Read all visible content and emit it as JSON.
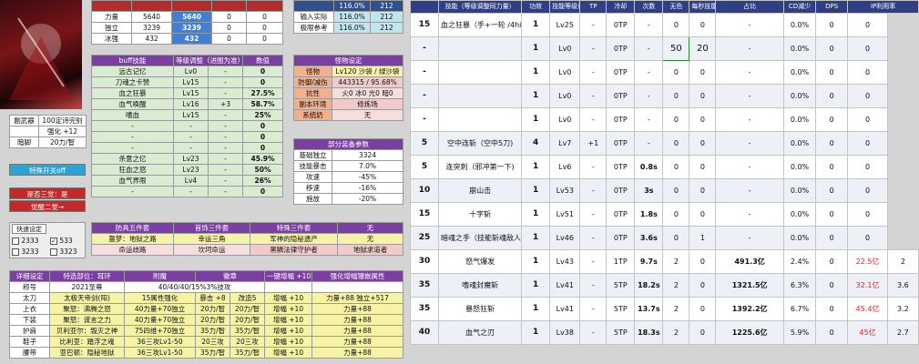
{
  "top_stats": {
    "rows": [
      [
        "力量",
        "5640",
        "5640",
        "0",
        "0"
      ],
      [
        "独立",
        "3239",
        "3239",
        "0",
        "0"
      ],
      [
        "冰强",
        "432",
        "432",
        "0",
        "0"
      ]
    ]
  },
  "top_info": {
    "headers": [
      "",
      "116.0%",
      "212"
    ],
    "rows": [
      [
        "输入实际",
        "116.0%",
        "212"
      ],
      [
        "极限参考",
        "116.0%",
        "212"
      ]
    ]
  },
  "weapon": {
    "rows": [
      [
        "副武器",
        "100定诗完别"
      ],
      [
        "",
        "强化 +12"
      ],
      [
        "暗脚",
        "20力/智"
      ]
    ]
  },
  "buttons": {
    "special_off": "特殊开关off",
    "is_three": "是否三觉：是",
    "awaken2": "觉醒二觉→",
    "quick_set": "快速设定"
  },
  "quick": {
    "items": [
      {
        "check": "",
        "val": "2333"
      },
      {
        "check": "✓",
        "val": "533"
      },
      {
        "check": "",
        "val": "3233"
      },
      {
        "check": "",
        "val": "3323"
      },
      {
        "check": "",
        "val": "3332"
      }
    ]
  },
  "buff": {
    "headers": [
      "buff技能",
      "等级调整（进图为准）",
      "数值"
    ],
    "rows": [
      [
        "远古记忆",
        "Lv0",
        "-",
        "0"
      ],
      [
        "刀魂之卡赞",
        "Lv15",
        "-",
        "0"
      ],
      [
        "血之狂暴",
        "Lv15",
        "-",
        "27.5%"
      ],
      [
        "血气唤醒",
        "Lv16",
        "+3",
        "58.7%"
      ],
      [
        "嗜血",
        "Lv15",
        "-",
        "25%"
      ],
      [
        "-",
        "-",
        "-",
        "0"
      ],
      [
        "-",
        "-",
        "-",
        "0"
      ],
      [
        "-",
        "-",
        "-",
        "0"
      ],
      [
        "杀意之忆",
        "Lv23",
        "-",
        "45.9%"
      ],
      [
        "狂血之怒",
        "Lv23",
        "-",
        "50%"
      ],
      [
        "血气界限",
        "Lv4",
        "-",
        "26%"
      ],
      [
        "-",
        "-",
        "-",
        "0"
      ]
    ]
  },
  "monster": {
    "header": "怪物设定",
    "rows": [
      [
        "怪物",
        "Lv120 沙袋 / 绿沙袋"
      ],
      [
        "防御/减伤",
        "443315 / 95.68%"
      ],
      [
        "抗性",
        "火0 冰0 光0 暗0"
      ],
      [
        "副本环境",
        "修炼场"
      ],
      [
        "系统奶",
        "无"
      ]
    ]
  },
  "partial": {
    "header": "部分装备参数",
    "rows": [
      [
        "基础独立",
        "3324"
      ],
      [
        "技能暴击",
        "7.0%"
      ],
      [
        "攻速",
        "-45%"
      ],
      [
        "移速",
        "-16%"
      ],
      [
        "施放",
        "-20%"
      ]
    ]
  },
  "set5": {
    "headers": [
      "防具五件套",
      "首饰三件套",
      "特殊三件套",
      "无"
    ],
    "rows": [
      [
        "噩梦：地狱之路",
        "幸运三角",
        "军神的隐秘遗产",
        "无"
      ],
      [
        "命运歧路",
        "坎坷命运",
        "黑鳞法律守护者",
        "地狱求道者"
      ]
    ]
  },
  "detail": {
    "headers": [
      "详细设定",
      "特选部位：耳环",
      "附魔",
      "徽章",
      "一键增幅 +10",
      "强化增幅镶嵌属性"
    ],
    "rows": [
      [
        "称号",
        "2021至尊",
        "40/40/40/15%3%技攻",
        "",
        "",
        ""
      ],
      [
        "太刀",
        "太极天帝剑(阳)",
        "15属性强化",
        "暴击 +8",
        "改造5",
        "增幅 +10",
        "力量+88 独立+517"
      ],
      [
        "上衣",
        "聚怒：沸腾之怒",
        "40力量+70独立",
        "20力/智",
        "20力/智",
        "增幅 +10",
        "力量+88"
      ],
      [
        "下装",
        "聚怒：谎言之力",
        "40力量+70独立",
        "20力/智",
        "20力/智",
        "增幅 +10",
        "力量+88"
      ],
      [
        "护肩",
        "贝利亚尔：毁灭之神",
        "75四维+70独立",
        "35力/智",
        "35力/智",
        "增幅 +10",
        "力量+88"
      ],
      [
        "鞋子",
        "比利亚：踏浮之魂",
        "36三攻Lv1-50",
        "20三攻",
        "20三攻",
        "增幅 +10",
        "力量+88"
      ],
      [
        "腰带",
        "亚巴顿：隐秘地狱",
        "36三攻Lv1-50",
        "35力/智",
        "35力/智",
        "增幅 +10",
        "力量+88"
      ]
    ]
  },
  "right": {
    "headers": [
      "",
      "技能（等级调整同力量）",
      "功效",
      "技能等级调整",
      "TP",
      "冷却",
      "次数",
      "无色",
      "每秒技能伤害",
      "占比",
      "CD减少",
      "DPS",
      "IP利用率"
    ],
    "rows": [
      [
        "15",
        "血之狂暴（手+一轮 /4hit)(TP为基础描述)",
        "1",
        "Lv25",
        "-",
        "0TP",
        "-",
        "0",
        "0",
        "-",
        "0.0%",
        "0",
        "0"
      ],
      [
        "-",
        "",
        "1",
        "Lv0",
        "-",
        "0TP",
        "-",
        "50",
        "20",
        "-",
        "0.0%",
        "0",
        "0"
      ],
      [
        "-",
        "",
        "1",
        "Lv0",
        "-",
        "0TP",
        "-",
        "0",
        "0",
        "-",
        "0.0%",
        "0",
        "0"
      ],
      [
        "-",
        "",
        "1",
        "Lv0",
        "-",
        "0TP",
        "-",
        "0",
        "0",
        "-",
        "0.0%",
        "0",
        "0"
      ],
      [
        "-",
        "",
        "1",
        "Lv0",
        "-",
        "0TP",
        "-",
        "0",
        "0",
        "-",
        "0.0%",
        "0",
        "0"
      ],
      [
        "5",
        "空中连斩（空中5刀)",
        "4",
        "Lv7",
        "+1",
        "0TP",
        "-",
        "0",
        "0",
        "-",
        "0.0%",
        "0",
        "0"
      ],
      [
        "5",
        "连突刺（邪冲第一下)",
        "1",
        "Lv6",
        "-",
        "0TP",
        "0.8s",
        "0",
        "0",
        "-",
        "0.0%",
        "0",
        "0"
      ],
      [
        "10",
        "崩山击",
        "1",
        "Lv53",
        "-",
        "0TP",
        "3s",
        "0",
        "0",
        "-",
        "0.0%",
        "0",
        "0"
      ],
      [
        "15",
        "十字斩",
        "1",
        "Lv51",
        "-",
        "0TP",
        "1.8s",
        "0",
        "0",
        "-",
        "0.0%",
        "0",
        "0"
      ],
      [
        "25",
        "暗魂之手（技能斩魂敌人)",
        "1",
        "Lv46",
        "-",
        "0TP",
        "3.6s",
        "0",
        "1",
        "-",
        "0.0%",
        "0",
        "0"
      ],
      [
        "30",
        "怒气爆发",
        "1",
        "Lv43",
        "-",
        "1TP",
        "9.7s",
        "2",
        "0",
        "491.3亿",
        "2.4%",
        "0",
        "22.5亿",
        "2"
      ],
      [
        "35",
        "嗜魂封魔斩",
        "1",
        "Lv41",
        "-",
        "5TP",
        "18.2s",
        "2",
        "0",
        "1321.5亿",
        "6.3%",
        "0",
        "32.1亿",
        "3.6"
      ],
      [
        "35",
        "暴怒狂斩",
        "1",
        "Lv41",
        "-",
        "5TP",
        "13.7s",
        "2",
        "0",
        "1392.2亿",
        "6.7%",
        "0",
        "45.4亿",
        "3.2"
      ],
      [
        "40",
        "血气之刃",
        "1",
        "Lv38",
        "-",
        "5TP",
        "18.3s",
        "2",
        "0",
        "1225.6亿",
        "5.9%",
        "0",
        "45亿",
        "2.7"
      ]
    ]
  }
}
